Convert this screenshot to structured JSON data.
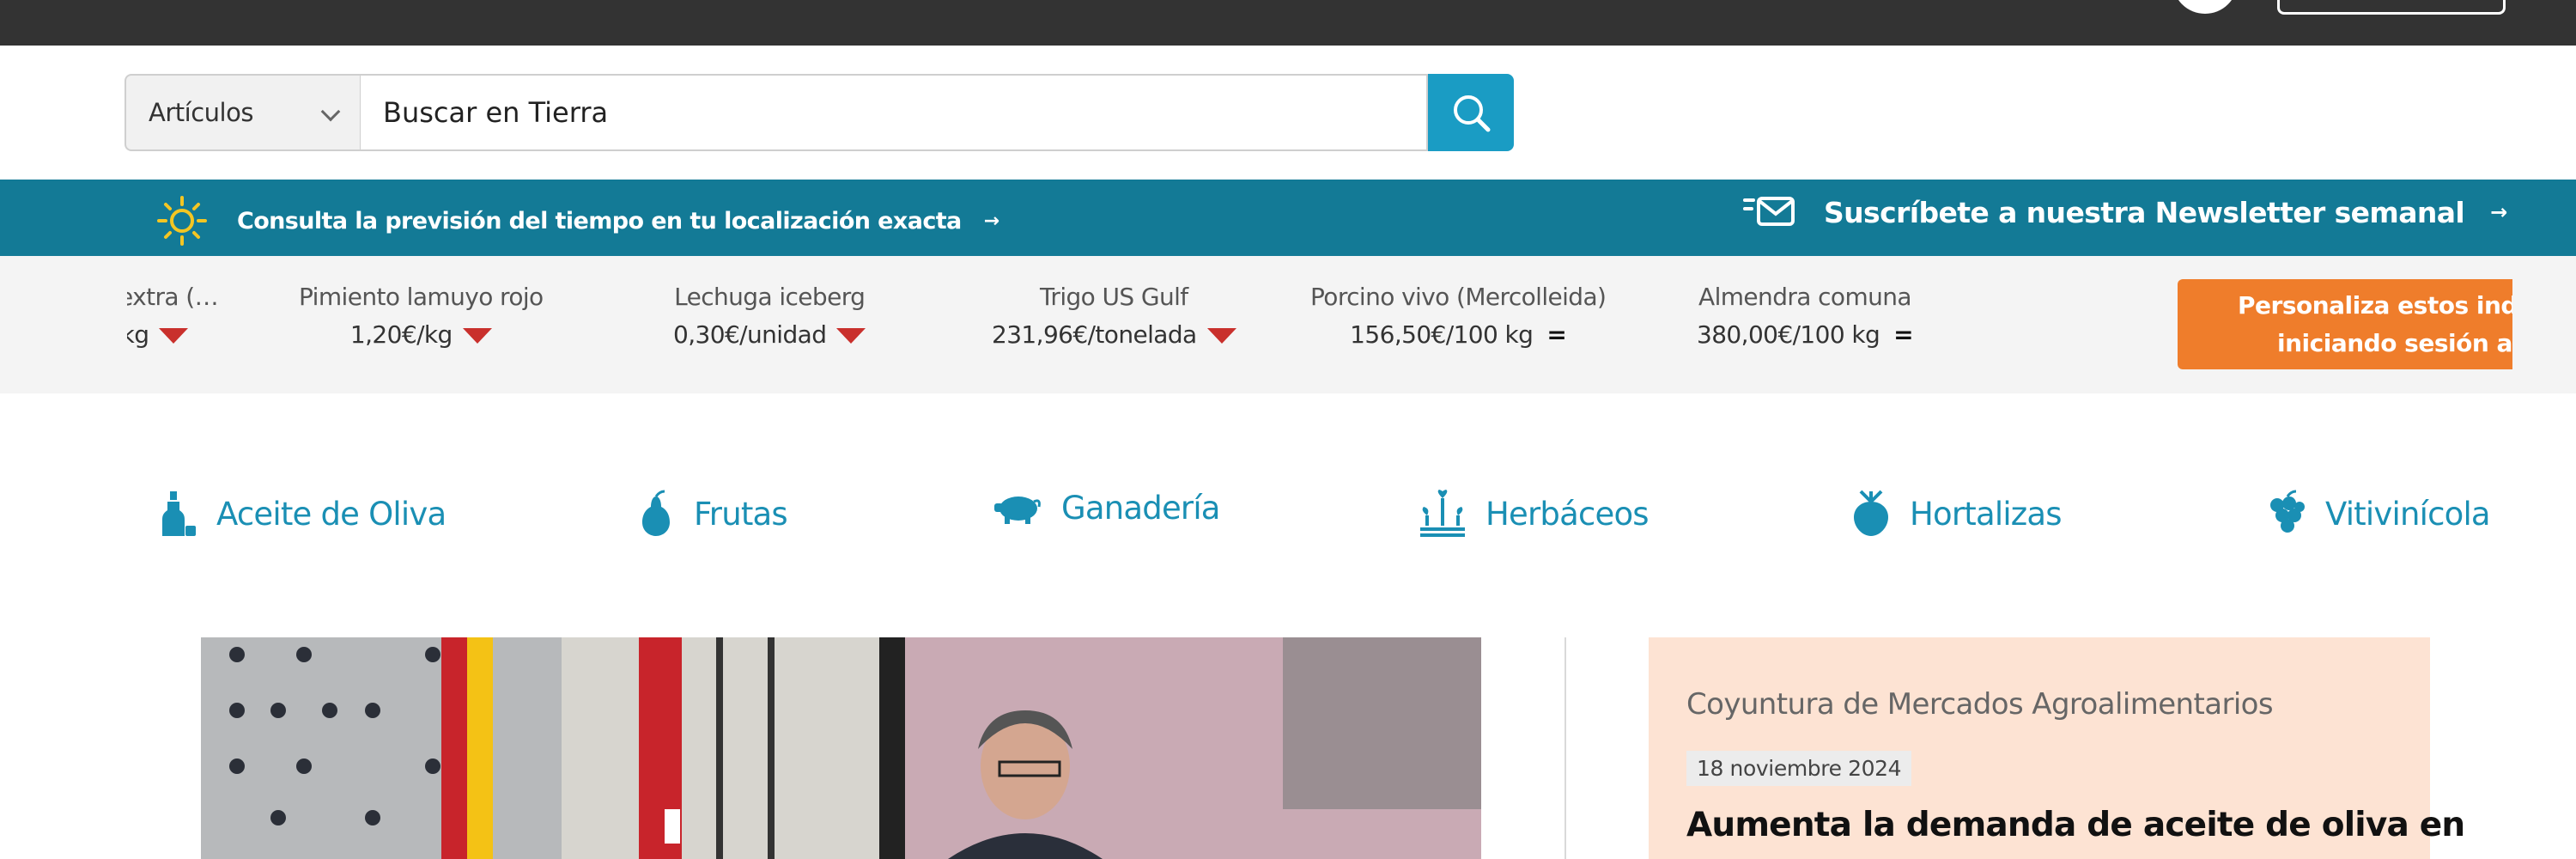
{
  "search": {
    "scope_label": "Artículos",
    "placeholder": "Buscar en Tierra"
  },
  "infobar": {
    "weather_text": "Consulta la previsión del tiempo en tu localización exacta",
    "newsletter_text": "Suscríbete a nuestra Newsletter semanal",
    "arrow": "→"
  },
  "ticker": {
    "items": [
      {
        "name": "extra (…",
        "value": "€/kg",
        "trend": "down"
      },
      {
        "name": "Pimiento lamuyo rojo",
        "value": "1,20€/kg",
        "trend": "down"
      },
      {
        "name": "Lechuga iceberg",
        "value": "0,30€/unidad",
        "trend": "down"
      },
      {
        "name": "Trigo US Gulf",
        "value": "231,96€/tonelada",
        "trend": "down"
      },
      {
        "name": "Porcino vivo (Mercolleida)",
        "value": "156,50€/100 kg",
        "trend": "equal",
        "symbol": "="
      },
      {
        "name": "Almendra comuna",
        "value": "380,00€/100 kg",
        "trend": "equal",
        "symbol": "="
      }
    ],
    "cta_line1": "Personaliza estos indicadores",
    "cta_line2": "iniciando sesión aquí"
  },
  "categories": [
    {
      "label": "Aceite de Oliva",
      "icon": "olive-oil-bottle-icon"
    },
    {
      "label": "Frutas",
      "icon": "pear-icon"
    },
    {
      "label": "Ganadería",
      "icon": "pig-icon"
    },
    {
      "label": "Herbáceos",
      "icon": "sprout-icon"
    },
    {
      "label": "Hortalizas",
      "icon": "beet-icon"
    },
    {
      "label": "Vitivinícola",
      "icon": "grape-icon"
    }
  ],
  "featured": {
    "section": "Coyuntura de Mercados Agroalimentarios",
    "date": "18 noviembre 2024",
    "headline": "Aumenta la demanda de aceite de oliva en"
  },
  "colors": {
    "topbar": "#333333",
    "accent_blue": "#1a9cc4",
    "infobar": "#137a96",
    "cta_orange": "#ef7d2b",
    "trend_down": "#c9302c",
    "card_bg": "#fde3d3"
  }
}
